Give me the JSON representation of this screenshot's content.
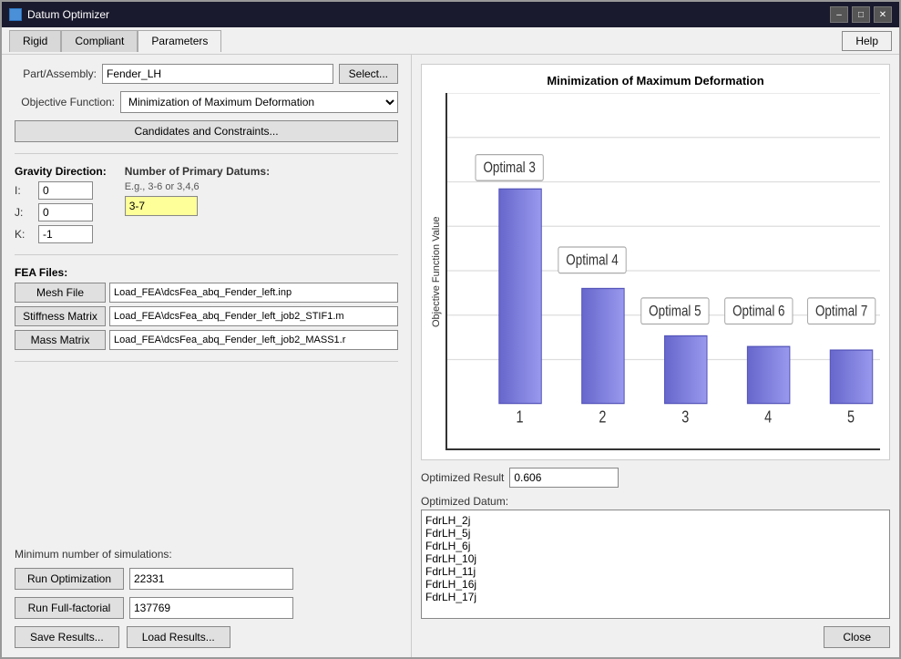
{
  "window": {
    "title": "Datum Optimizer"
  },
  "tabs": [
    {
      "label": "Rigid",
      "active": false
    },
    {
      "label": "Compliant",
      "active": false
    },
    {
      "label": "Parameters",
      "active": true
    }
  ],
  "help_button": "Help",
  "form": {
    "part_label": "Part/Assembly:",
    "part_value": "Fender_LH",
    "select_button": "Select...",
    "objective_label": "Objective Function:",
    "objective_value": "Minimization of Maximum Deformation",
    "candidates_button": "Candidates and Constraints...",
    "gravity_label": "Gravity Direction:",
    "gravity_i_label": "I:",
    "gravity_i_value": "0",
    "gravity_j_label": "J:",
    "gravity_j_value": "0",
    "gravity_k_label": "K:",
    "gravity_k_value": "-1",
    "primary_datums_label": "Number of Primary Datums:",
    "primary_datums_hint": "E.g., 3-6 or 3,4,6",
    "primary_datums_value": "3-7",
    "fea_label": "FEA Files:",
    "mesh_btn": "Mesh File",
    "mesh_value": "Load_FEA\\dcsFea_abq_Fender_left.inp",
    "stiffness_btn": "Stiffness Matrix",
    "stiffness_value": "Load_FEA\\dcsFea_abq_Fender_left_job2_STIF1.m",
    "mass_btn": "Mass Matrix",
    "mass_value": "Load_FEA\\dcsFea_abq_Fender_left_job2_MASS1.r",
    "min_sims_label": "Minimum number of simulations:",
    "run_opt_btn": "Run Optimization",
    "run_opt_value": "22331",
    "run_full_btn": "Run Full-factorial",
    "run_full_value": "137769",
    "save_btn": "Save Results...",
    "load_btn": "Load Results..."
  },
  "chart": {
    "title": "Minimization of Maximum Deformation",
    "y_axis_label": "Objective Function Value",
    "y_ticks": [
      "0.0",
      "0.5",
      "1.0",
      "1.5",
      "2.0",
      "2.5",
      "3.0",
      "3.5",
      "4.0"
    ],
    "x_ticks": [
      "1",
      "2",
      "3",
      "4",
      "5"
    ],
    "bars": [
      {
        "x": 1,
        "value": 2.42,
        "height_pct": 60.5
      },
      {
        "x": 2,
        "value": 1.3,
        "height_pct": 32.5
      },
      {
        "x": 3,
        "value": 0.76,
        "height_pct": 19.0
      },
      {
        "x": 4,
        "value": 0.64,
        "height_pct": 16.0
      },
      {
        "x": 5,
        "value": 0.606,
        "height_pct": 15.15
      }
    ],
    "labels": [
      {
        "text": "Optimal 3",
        "x": 1
      },
      {
        "text": "Optimal 4",
        "x": 2
      },
      {
        "text": "Optimal 5",
        "x": 3
      },
      {
        "text": "Optimal 6",
        "x": 4
      },
      {
        "text": "Optimal 7",
        "x": 5
      }
    ]
  },
  "result": {
    "label": "Optimized Result",
    "value": "0.606",
    "datum_label": "Optimized Datum:",
    "datum_items": [
      "FdrLH_2j",
      "FdrLH_5j",
      "FdrLH_6j",
      "FdrLH_10j",
      "FdrLH_11j",
      "FdrLH_16j",
      "FdrLH_17j"
    ]
  },
  "close_button": "Close"
}
